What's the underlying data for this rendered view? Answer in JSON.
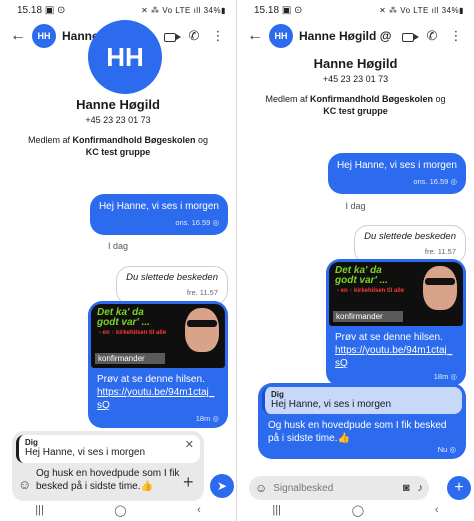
{
  "status_bar": {
    "time": "15.18",
    "left_icons": "▣ ⊙",
    "right_icons": "✕ ⁂ Vo LTE ıll 34%▮"
  },
  "contact": {
    "name": "Hanne Høgild",
    "title_suffix": "@",
    "initials": "HH",
    "phone": "+45 23 23 01 73",
    "groups_prefix": "Medlem af",
    "group1": "Konfirmandhold Bøgeskolen",
    "groups_join": "og",
    "group2": "KC test gruppe"
  },
  "icons": {
    "back": "back-arrow-icon",
    "video": "video-call-icon",
    "call": "phone-icon",
    "more": "more-vert-icon"
  },
  "messages": {
    "m1": {
      "text": "Hej Hanne, vi ses i morgen",
      "time": "ons. 16.59",
      "status": "◎"
    },
    "day": "I dag",
    "deleted": {
      "text": "Du slettede beskeden",
      "time": "fre. 11.57"
    },
    "media": {
      "thumb_line1": "Det ka' da",
      "thumb_line2": "godt var' ...",
      "thumb_line3": "- en ↑ kirkehilsen til alle",
      "thumb_line4": "konfirmander",
      "caption": "Prøv at se denne hilsen.",
      "link": "https://youtu.be/94m1ctaj_sQ",
      "time": "18m",
      "status": "◎"
    },
    "reply": {
      "quote_author": "Dig",
      "quote_text": "Hej Hanne, vi ses i morgen",
      "text": "Og husk en hovedpude som I fik besked på i sidste time.👍",
      "time": "Nu",
      "status": "◎"
    }
  },
  "composer_left": {
    "quote_author": "Dig",
    "quote_text": "Hej Hanne, vi ses i morgen",
    "close": "✕",
    "draft": "Og husk en hovedpude som I fik besked på i sidste time.👍",
    "plus": "+",
    "send": "➤"
  },
  "composer_right": {
    "placeholder": "Signalbesked",
    "camera": "◙",
    "mic": "🎙",
    "plus": "+"
  },
  "nav": {
    "recents": "|||",
    "home": "◯",
    "back": "‹"
  },
  "colors": {
    "accent": "#2c6bed",
    "quote_bg": "#c8d8fb"
  }
}
